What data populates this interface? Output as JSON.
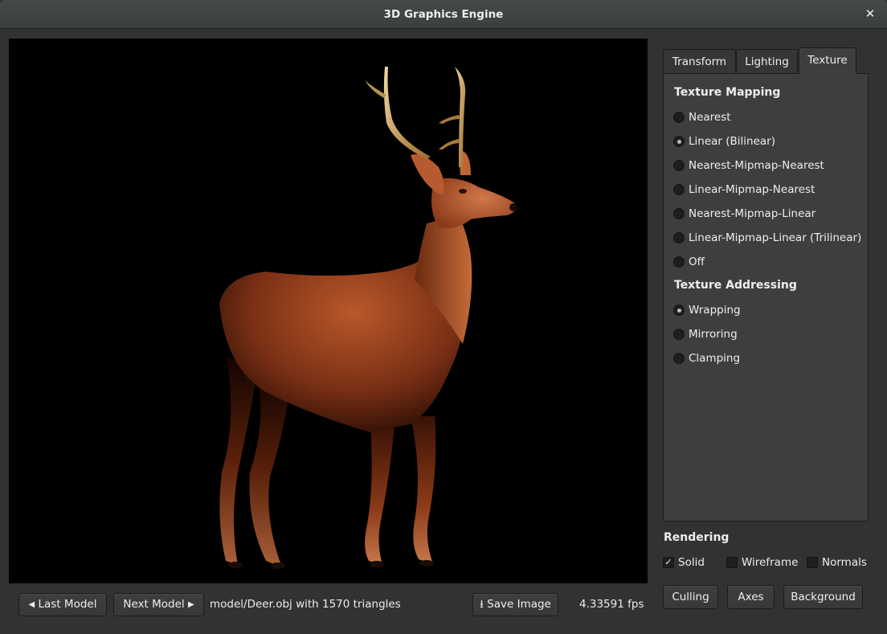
{
  "window": {
    "title": "3D Graphics Engine",
    "close_glyph": "✕"
  },
  "viewport": {
    "background": "#000000",
    "scene": "Textured deer model rendered with lighting"
  },
  "bottom_bar": {
    "last_model_label": "Last Model",
    "last_model_glyph": "◀",
    "next_model_label": "Next Model",
    "next_model_glyph": "▶",
    "model_info": "model/Deer.obj with 1570 triangles",
    "save_image_glyph": "⭳",
    "save_image_label": "Save Image",
    "fps": "4.33591 fps"
  },
  "tabs": [
    {
      "label": "Transform",
      "active": false
    },
    {
      "label": "Lighting",
      "active": false
    },
    {
      "label": "Texture",
      "active": true
    }
  ],
  "texture": {
    "mapping_title": "Texture Mapping",
    "mapping_options": [
      {
        "label": "Nearest",
        "checked": false
      },
      {
        "label": "Linear (Bilinear)",
        "checked": true
      },
      {
        "label": "Nearest-Mipmap-Nearest",
        "checked": false
      },
      {
        "label": "Linear-Mipmap-Nearest",
        "checked": false
      },
      {
        "label": "Nearest-Mipmap-Linear",
        "checked": false
      },
      {
        "label": "Linear-Mipmap-Linear (Trilinear)",
        "checked": false
      },
      {
        "label": "Off",
        "checked": false
      }
    ],
    "addressing_title": "Texture Addressing",
    "addressing_options": [
      {
        "label": "Wrapping",
        "checked": true
      },
      {
        "label": "Mirroring",
        "checked": false
      },
      {
        "label": "Clamping",
        "checked": false
      }
    ]
  },
  "rendering": {
    "title": "Rendering",
    "checkboxes": [
      {
        "label": "Solid",
        "checked": true
      },
      {
        "label": "Wireframe",
        "checked": false
      },
      {
        "label": "Normals",
        "checked": false
      }
    ],
    "check_glyph": "✓",
    "buttons": [
      "Culling",
      "Axes",
      "Background"
    ]
  }
}
